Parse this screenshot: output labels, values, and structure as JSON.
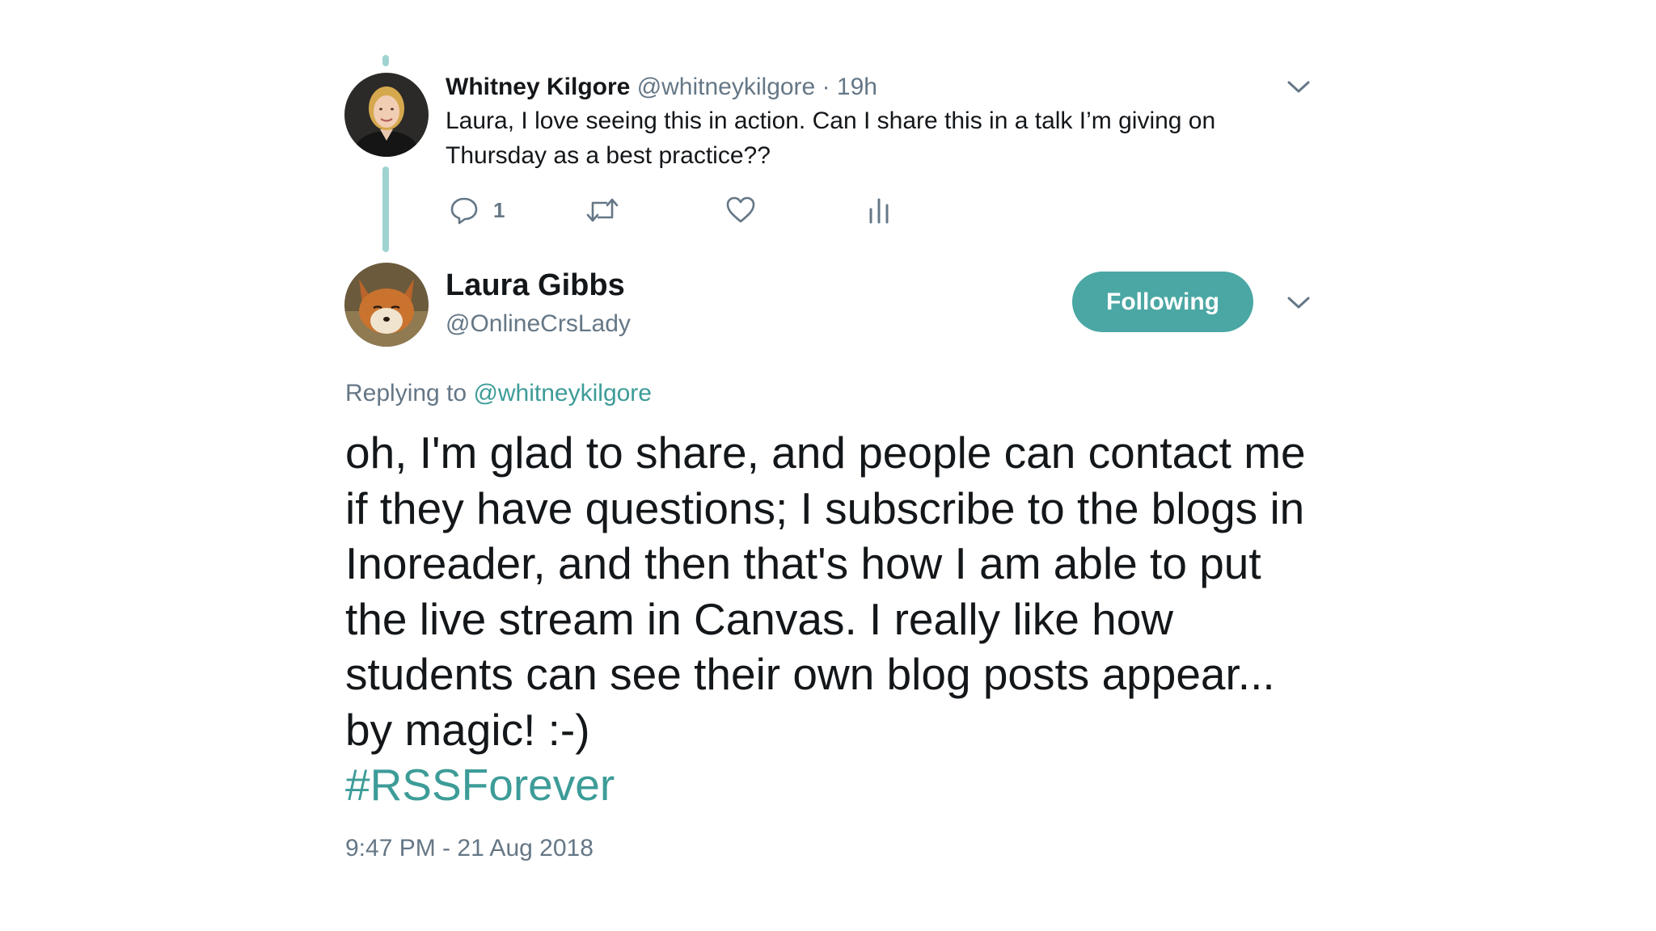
{
  "parent_tweet": {
    "author_name": "Whitney Kilgore",
    "author_handle": "@whitneykilgore",
    "separator": "·",
    "time": "19h",
    "text": "Laura, I love seeing this in action. Can I share this in a talk I’m giving on Thursday as a best practice??",
    "reply_count": "1",
    "icons": {
      "reply": "reply-icon",
      "retweet": "retweet-icon",
      "like": "heart-icon",
      "stats": "analytics-icon",
      "menu": "chevron-down-icon"
    }
  },
  "reply_tweet": {
    "author_name": "Laura Gibbs",
    "author_handle": "@OnlineCrsLady",
    "follow_label": "Following",
    "replying_prefix": "Replying to",
    "replying_to": "@whitneykilgore",
    "text": "oh, I'm glad to share, and people can contact me if they have questions; I subscribe to the blogs in Inoreader, and then that's how I am able to put the live stream in Canvas. I really like how students can see their own blog posts appear... by magic! :-)",
    "hashtag": "#RSSForever",
    "timestamp": "9:47 PM - 21 Aug 2018"
  },
  "colors": {
    "accent": "#4aa7a4",
    "link": "#3d9c98",
    "thread_line": "#9fd3cf",
    "secondary_text": "#657786",
    "primary_text": "#14171a"
  }
}
